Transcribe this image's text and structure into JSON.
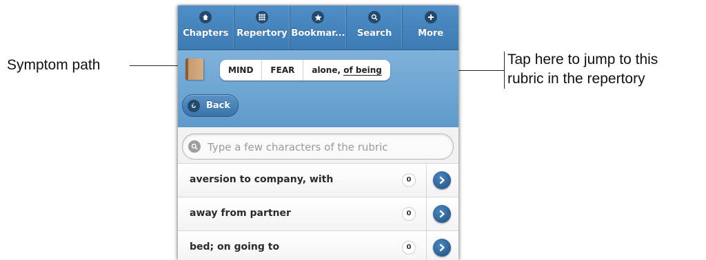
{
  "annotations": {
    "left": "Symptom path",
    "right_line1": "Tap here to jump to this",
    "right_line2": "rubric in the repertory"
  },
  "nav": {
    "items": [
      {
        "label": "Chapters",
        "icon": "chapters-icon"
      },
      {
        "label": "Repertory",
        "icon": "grid-icon"
      },
      {
        "label": "Bookmar...",
        "icon": "star-icon"
      },
      {
        "label": "Search",
        "icon": "search-icon"
      },
      {
        "label": "More",
        "icon": "plus-icon"
      }
    ]
  },
  "breadcrumb": {
    "segments": [
      "MIND",
      "FEAR"
    ],
    "last_prefix": "alone, ",
    "last_underlined": "of being"
  },
  "back": {
    "label": "Back"
  },
  "search": {
    "placeholder": "Type a few characters of the rubric",
    "value": ""
  },
  "rubrics": [
    {
      "label": "aversion to company, with",
      "count": "0"
    },
    {
      "label": "away from partner",
      "count": "0"
    },
    {
      "label": "bed; on going to",
      "count": "0"
    }
  ],
  "colors": {
    "accent": "#4f8fc6",
    "header": "#6fa6d3",
    "arrow": "#1f4d7d"
  }
}
